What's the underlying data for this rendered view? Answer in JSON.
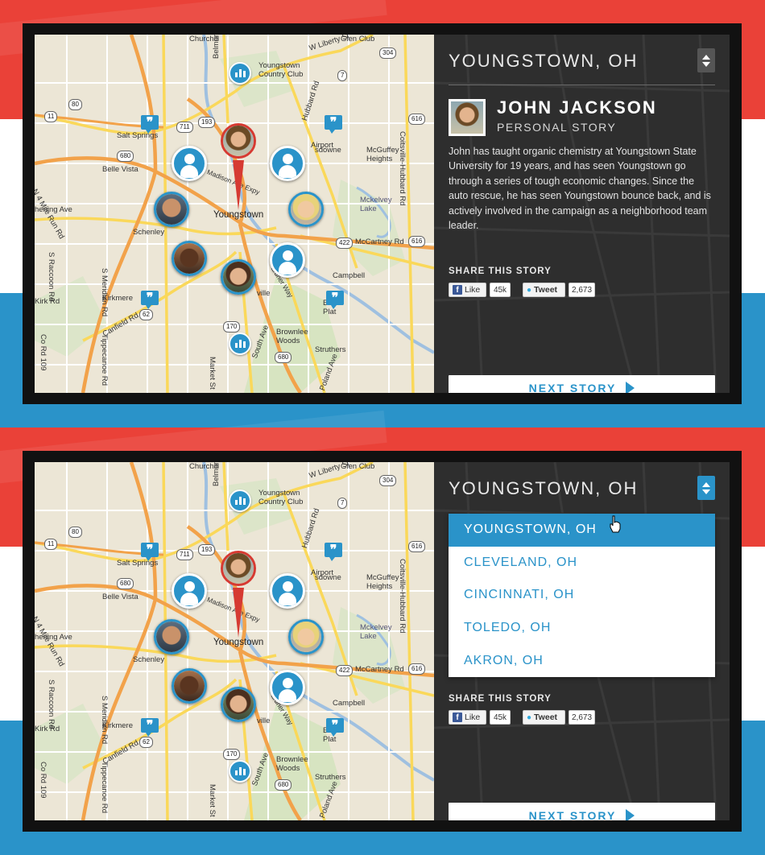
{
  "city": "YOUNGSTOWN, OH",
  "person": {
    "name": "JOHN JACKSON",
    "subtitle": "PERSONAL STORY",
    "story": "John has taught organic chemistry at Youngstown State University for 19 years, and has seen Youngstown go through a series of tough economic changes. Since the auto rescue, he has seen Youngstown bounce back, and is actively involved in the campaign as a neighborhood team leader."
  },
  "share": {
    "heading": "SHARE THIS STORY",
    "like_label": "Like",
    "like_count": "45k",
    "tweet_label": "Tweet",
    "tweet_count": "2,673"
  },
  "next_story": "NEXT STORY",
  "dropdown": {
    "options": [
      "YOUNGSTOWN, OH",
      "CLEVELAND, OH",
      "CINCINNATI, OH",
      "TOLEDO, OH",
      "AKRON, OH"
    ],
    "selected": "YOUNGSTOWN, OH"
  },
  "map": {
    "labels": {
      "churchill": "Churchill",
      "w_liberty_st": "W Liberty St",
      "glen_club": "Glen Club",
      "youngstown_cc": "Youngstown\nCountry Club",
      "salt_springs": "Salt Springs",
      "belle_vista": "Belle Vista",
      "youngstown": "Youngstown",
      "schenley": "Schenley",
      "campbell": "Campbell",
      "mcguffey": "McGuffey\nHeights",
      "kirkmere": "Kirkmere",
      "brownlee": "Brownlee\nWoods",
      "struthers": "Struthers",
      "mckelvey": "Mckelvey\nLake",
      "airport": "Airport",
      "lansdowne": "sdowne",
      "mccartney_rd": "McCartney Rd",
      "madison_expy": "Madison Ave Expy",
      "canfield_rd": "Canfield Rd",
      "n4_mile_run": "N 4 Mile Run Rd",
      "s_raccoon_rd": "S Raccoon Rd",
      "s_meridian_rd": "S Meridian Rd",
      "belmont_ave": "Belmont Ave",
      "hubbard_rd": "Hubbard Rd",
      "coitsville_rd": "Coitsville-Hubbard Rd",
      "south_ave": "South Ave",
      "poland_ave": "Poland Ave",
      "co_rd_109": "Co Rd 109",
      "tippecanoe_rd": "Tippecanoe Rd",
      "market_st": "Market St",
      "kirk_rd": "Kirk Rd",
      "bucke_plat": "Bucke\nPlat",
      "ville": "ville",
      "opening_ave": "hening Ave",
      "wardner_way": "ardner Way",
      "i80": "80",
      "r304": "304",
      "r7": "7",
      "r711": "711",
      "r193": "193",
      "r680": "680",
      "r616": "616",
      "r11": "11",
      "r422": "422",
      "r62": "62",
      "r170": "170"
    }
  }
}
